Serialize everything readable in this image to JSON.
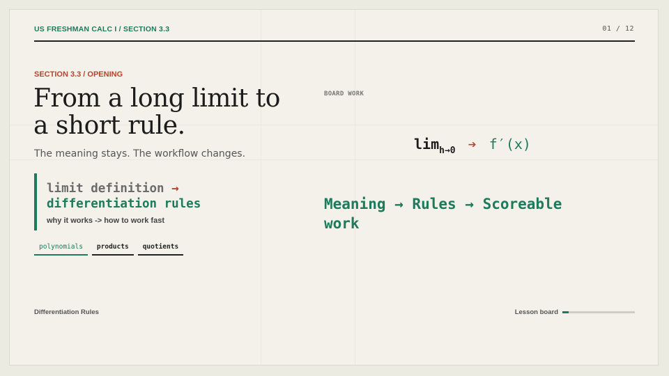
{
  "header": {
    "course_label": "US FRESHMAN CALC I / SECTION 3.3",
    "page_counter": "01 / 12"
  },
  "intro": {
    "section_label": "SECTION 3.3 / OPENING",
    "headline_line1": "From a long limit to",
    "headline_line2": "a short rule.",
    "subtitle": "The meaning stays. The workflow changes."
  },
  "callout": {
    "line1": "limit definition",
    "arrow": "→",
    "line2": "differentiation rules",
    "note": "why it works -> how to work fast"
  },
  "tags": [
    {
      "label": "polynomials",
      "active": true
    },
    {
      "label": "products",
      "active": false
    },
    {
      "label": "quotients",
      "active": false
    }
  ],
  "board": {
    "label": "BOARD WORK",
    "formula_lim": "lim",
    "formula_sub": "h→0",
    "formula_arrow": "➔",
    "formula_result": "f′(x)",
    "workflow_line1": "Meaning → Rules → Scoreable",
    "workflow_line2": "work"
  },
  "footer": {
    "title": "Differentiation Rules",
    "progress_label": "Lesson board",
    "progress_fraction": 0.083
  },
  "colors": {
    "accent_green": "#1d7a5c",
    "accent_red": "#b3462c",
    "ink": "#1c1c1c",
    "paper": "#f3f1e9"
  }
}
